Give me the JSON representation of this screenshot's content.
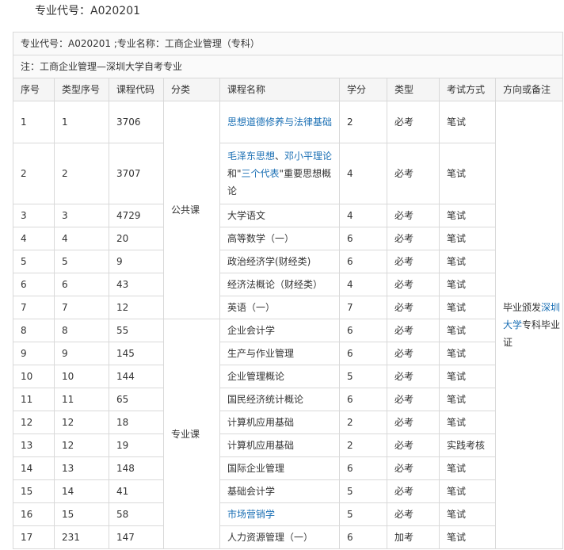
{
  "heading": "专业代号：A020201",
  "banner": {
    "line1": "专业代号：A020201 ;专业名称：工商企业管理（专科）",
    "line2": "注：工商企业管理—深圳大学自考专业"
  },
  "columns": [
    "序号",
    "类型序号",
    "课程代码",
    "分类",
    "课程名称",
    "学分",
    "类型",
    "考试方式",
    "方向或备注"
  ],
  "groups": {
    "public": "公共课",
    "major": "专业课"
  },
  "remark": {
    "part1": "毕业颁发",
    "link": "深圳大学",
    "part2": "专科毕业证"
  },
  "rows": [
    {
      "no": "1",
      "type_no": "1",
      "code": "3706",
      "name": "思想道德修养与法律基础",
      "credit": "2",
      "kind": "必考",
      "exam": "笔试"
    },
    {
      "no": "2",
      "type_no": "2",
      "code": "3707",
      "name_parts": [
        "毛泽东思想",
        "、",
        "邓小平理论",
        "和\"",
        "三个代表",
        "\"重要思想概论"
      ],
      "credit": "4",
      "kind": "必考",
      "exam": "笔试"
    },
    {
      "no": "3",
      "type_no": "3",
      "code": "4729",
      "name": "大学语文",
      "credit": "4",
      "kind": "必考",
      "exam": "笔试"
    },
    {
      "no": "4",
      "type_no": "4",
      "code": "20",
      "name": "高等数学（一）",
      "credit": "6",
      "kind": "必考",
      "exam": "笔试"
    },
    {
      "no": "5",
      "type_no": "5",
      "code": "9",
      "name": "政治经济学(财经类)",
      "credit": "6",
      "kind": "必考",
      "exam": "笔试"
    },
    {
      "no": "6",
      "type_no": "6",
      "code": "43",
      "name": "经济法概论（财经类）",
      "credit": "4",
      "kind": "必考",
      "exam": "笔试"
    },
    {
      "no": "7",
      "type_no": "7",
      "code": "12",
      "name": "英语（一）",
      "credit": "7",
      "kind": "必考",
      "exam": "笔试"
    },
    {
      "no": "8",
      "type_no": "8",
      "code": "55",
      "name": "企业会计学",
      "credit": "6",
      "kind": "必考",
      "exam": "笔试"
    },
    {
      "no": "9",
      "type_no": "9",
      "code": "145",
      "name": "生产与作业管理",
      "credit": "6",
      "kind": "必考",
      "exam": "笔试"
    },
    {
      "no": "10",
      "type_no": "10",
      "code": "144",
      "name": "企业管理概论",
      "credit": "5",
      "kind": "必考",
      "exam": "笔试"
    },
    {
      "no": "11",
      "type_no": "11",
      "code": "65",
      "name": "国民经济统计概论",
      "credit": "6",
      "kind": "必考",
      "exam": "笔试"
    },
    {
      "no": "12",
      "type_no": "12",
      "code": "18",
      "name": "计算机应用基础",
      "credit": "2",
      "kind": "必考",
      "exam": "笔试"
    },
    {
      "no": "13",
      "type_no": "12",
      "code": "19",
      "name": "计算机应用基础",
      "credit": "2",
      "kind": "必考",
      "exam": "实践考核"
    },
    {
      "no": "14",
      "type_no": "13",
      "code": "148",
      "name": "国际企业管理",
      "credit": "6",
      "kind": "必考",
      "exam": "笔试"
    },
    {
      "no": "15",
      "type_no": "14",
      "code": "41",
      "name": "基础会计学",
      "credit": "5",
      "kind": "必考",
      "exam": "笔试"
    },
    {
      "no": "16",
      "type_no": "15",
      "code": "58",
      "name": "市场营销学",
      "credit": "5",
      "kind": "必考",
      "exam": "笔试"
    },
    {
      "no": "17",
      "type_no": "231",
      "code": "147",
      "name": "人力资源管理（一）",
      "credit": "6",
      "kind": "加考",
      "exam": "笔试"
    }
  ]
}
